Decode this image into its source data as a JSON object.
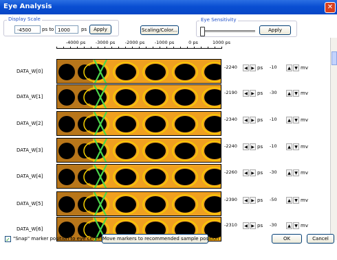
{
  "window": {
    "title": "Eye Analysis",
    "close_glyph": "✕"
  },
  "display_scale": {
    "label": "Display Scale",
    "from_value": "-4500",
    "to_label": "ps to",
    "to_value": "1000",
    "unit": "ps",
    "apply_label": "Apply"
  },
  "scaling_color_label": "Scaling/Color...",
  "eye_sensitivity": {
    "label": "Eye Sensitivity",
    "apply_label": "Apply",
    "level": 0
  },
  "scale_ticks": [
    "-4000 ps",
    "-3000 ps",
    "-2000 ps",
    "-1000 ps",
    "0 ps",
    "1000 ps"
  ],
  "time_unit": "ps",
  "voltage_unit": "mv",
  "rows": [
    {
      "name": "DATA_W[0]",
      "time": "-2240",
      "voltage": "-10"
    },
    {
      "name": "DATA_W[1]",
      "time": "-2190",
      "voltage": "-30"
    },
    {
      "name": "DATA_W[2]",
      "time": "-2340",
      "voltage": "-10"
    },
    {
      "name": "DATA_W[3]",
      "time": "-2240",
      "voltage": "-10"
    },
    {
      "name": "DATA_W[4]",
      "time": "-2260",
      "voltage": "-30"
    },
    {
      "name": "DATA_W[5]",
      "time": "-2390",
      "voltage": "-50"
    },
    {
      "name": "DATA_W[6]",
      "time": "-2310",
      "voltage": "-30"
    }
  ],
  "footer": {
    "snap_label": "\"Snap\" marker position to eye center?",
    "snap_checked": true,
    "move_markers_label": "Move markers to recommended sample position",
    "ok_label": "OK",
    "cancel_label": "Cancel"
  },
  "colors": {
    "titlebar": "#0a4fd2",
    "eye_body": "#f0a020",
    "eye_hole": "#000000",
    "marker": "#4cd64c"
  }
}
